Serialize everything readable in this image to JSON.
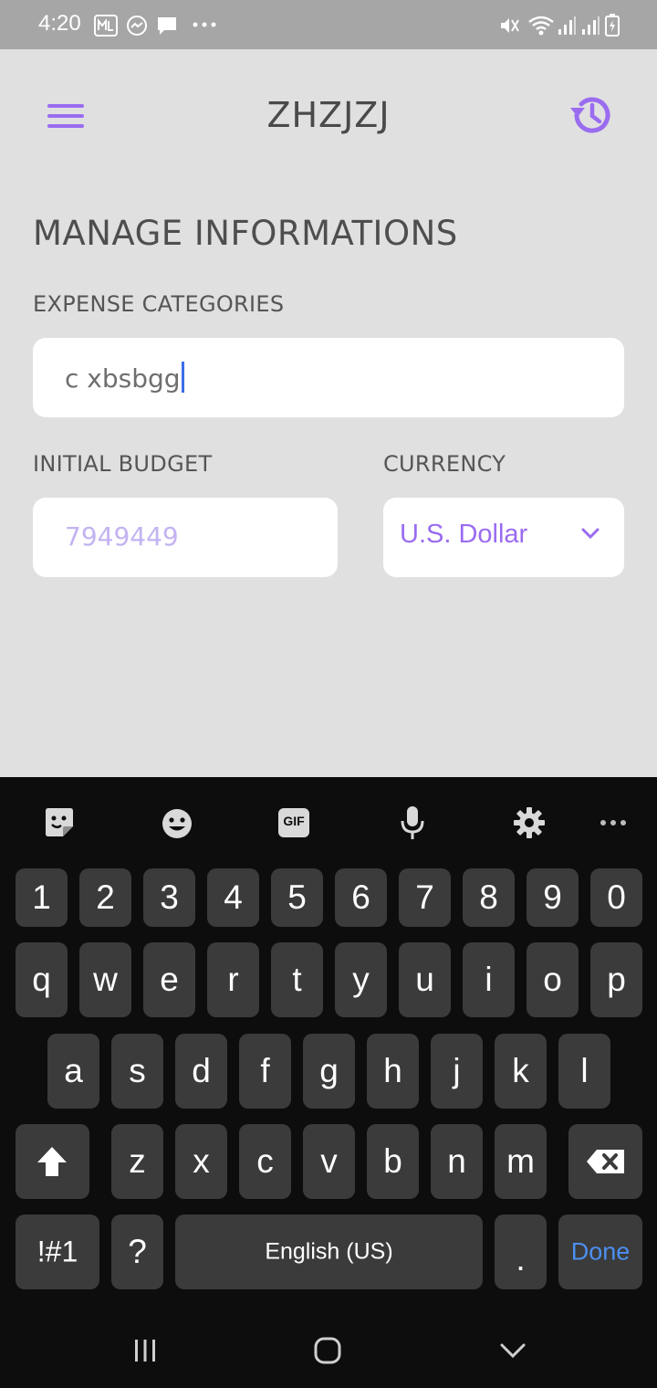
{
  "status_bar": {
    "time": "4:20",
    "notification_icons": [
      "mail-icon",
      "messenger-icon",
      "chat-icon",
      "more-dots-icon"
    ],
    "system_icons": [
      "mute-icon",
      "wifi-icon",
      "signal-icon",
      "signal-icon",
      "battery-charging-icon"
    ]
  },
  "header": {
    "title": "ZHZJZJ",
    "menu_icon": "hamburger-menu-icon",
    "history_icon": "history-icon"
  },
  "form": {
    "section_title": "MANAGE INFORMATIONS",
    "expense_categories_label": "EXPENSE CATEGORIES",
    "expense_categories_value": "c xbsbgg",
    "initial_budget_label": "INITIAL BUDGET",
    "initial_budget_placeholder": "7949449",
    "currency_label": "CURRENCY",
    "currency_value": "U.S. Dollar"
  },
  "keyboard": {
    "toolbar_icons": [
      "sticker-icon",
      "emoji-icon",
      "gif-icon",
      "microphone-icon",
      "settings-icon",
      "more-icon"
    ],
    "gif_label": "GIF",
    "row_numbers": [
      "1",
      "2",
      "3",
      "4",
      "5",
      "6",
      "7",
      "8",
      "9",
      "0"
    ],
    "row_1": [
      "q",
      "w",
      "e",
      "r",
      "t",
      "y",
      "u",
      "i",
      "o",
      "p"
    ],
    "row_2": [
      "a",
      "s",
      "d",
      "f",
      "g",
      "h",
      "j",
      "k",
      "l"
    ],
    "row_3": [
      "z",
      "x",
      "c",
      "v",
      "b",
      "n",
      "m"
    ],
    "symbols_key": "!#1",
    "question_key": "?",
    "space_key": "English (US)",
    "period_key": ".",
    "done_key": "Done"
  },
  "colors": {
    "accent": "#9a6cf0",
    "background": "#e0e0e0",
    "keyboard_bg": "#0d0d0d",
    "key_bg": "#3b3b3b",
    "done_text": "#4c8ff0"
  }
}
